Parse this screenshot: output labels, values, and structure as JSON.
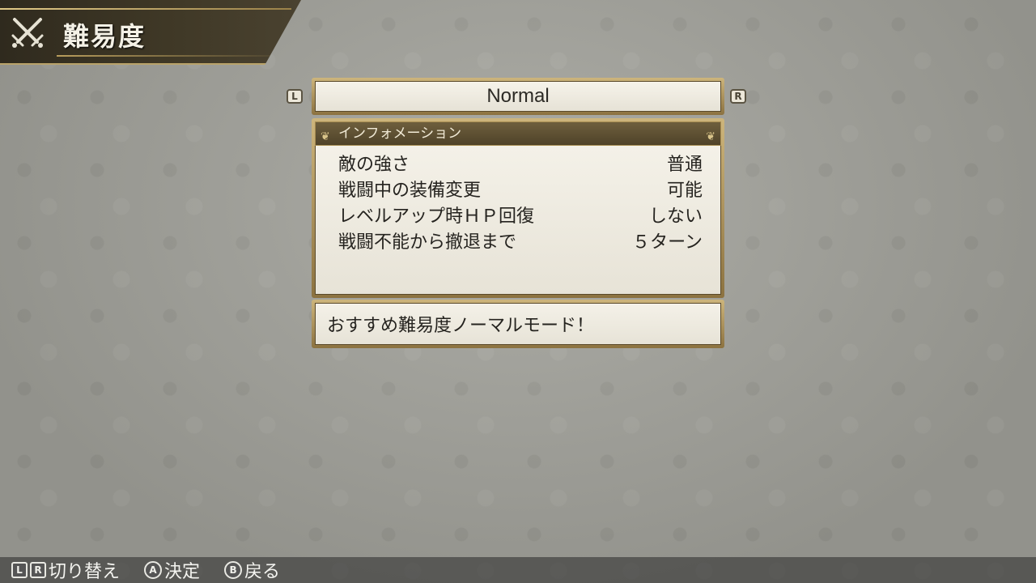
{
  "header": {
    "title": "難易度",
    "icon": "crossed-swords-icon"
  },
  "selector": {
    "left_button": "L",
    "right_button": "R",
    "value": "Normal"
  },
  "info": {
    "heading": "インフォメーション",
    "rows": [
      {
        "label": "敵の強さ",
        "value": "普通"
      },
      {
        "label": "戦闘中の装備変更",
        "value": "可能"
      },
      {
        "label": "レベルアップ時ＨＰ回復",
        "value": "しない"
      },
      {
        "label": "戦闘不能から撤退まで",
        "value": "５ターン"
      }
    ]
  },
  "message": "おすすめ難易度ノーマルモード！",
  "controls": {
    "switch_keys": [
      "L",
      "R"
    ],
    "switch_label": "切り替え",
    "confirm_key": "A",
    "confirm_label": "決定",
    "back_key": "B",
    "back_label": "戻る"
  },
  "colors": {
    "gold": "#cdb57c",
    "panel": "#f4f1e8",
    "title_bg": "#3f3826"
  }
}
